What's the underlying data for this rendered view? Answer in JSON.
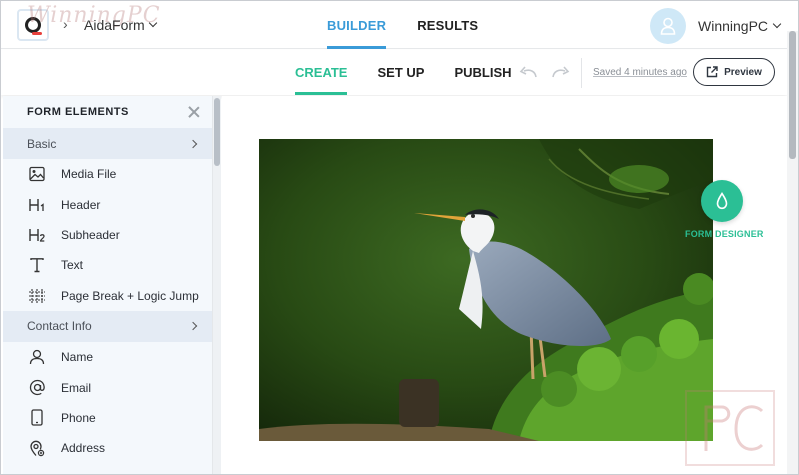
{
  "app": {
    "form_name": "AidaForm",
    "watermark": "WinningPC",
    "breadcrumb_sep": "›"
  },
  "top_tabs": [
    {
      "label": "BUILDER",
      "active": true
    },
    {
      "label": "RESULTS",
      "active": false
    }
  ],
  "user": {
    "name": "WinningPC"
  },
  "toolbar": {
    "tabs": [
      {
        "label": "CREATE",
        "active": true
      },
      {
        "label": "SET UP",
        "active": false
      },
      {
        "label": "PUBLISH",
        "active": false
      }
    ],
    "saved_text": "Saved 4 minutes ago",
    "preview_label": "Preview"
  },
  "sidebar": {
    "title": "FORM ELEMENTS",
    "sections": [
      {
        "label": "Basic",
        "items": [
          {
            "label": "Media File",
            "icon": "image-icon"
          },
          {
            "label": "Header",
            "icon": "h1-icon",
            "glyph": "H1"
          },
          {
            "label": "Subheader",
            "icon": "h2-icon",
            "glyph": "H2"
          },
          {
            "label": "Text",
            "icon": "text-icon",
            "glyph": "T"
          },
          {
            "label": "Page Break + Logic Jump",
            "icon": "page-break-icon"
          }
        ]
      },
      {
        "label": "Contact Info",
        "items": [
          {
            "label": "Name",
            "icon": "person-icon"
          },
          {
            "label": "Email",
            "icon": "at-icon",
            "glyph": "@"
          },
          {
            "label": "Phone",
            "icon": "phone-icon"
          },
          {
            "label": "Address",
            "icon": "location-icon"
          }
        ]
      }
    ]
  },
  "designer": {
    "label": "FORM DESIGNER"
  },
  "colors": {
    "accent_green": "#2bbf95",
    "accent_blue": "#3a9bd8",
    "sidebar_bg": "#f4f8fc",
    "section_bg": "#e4ebf4"
  },
  "corner_watermark": {
    "letters": "PC"
  }
}
